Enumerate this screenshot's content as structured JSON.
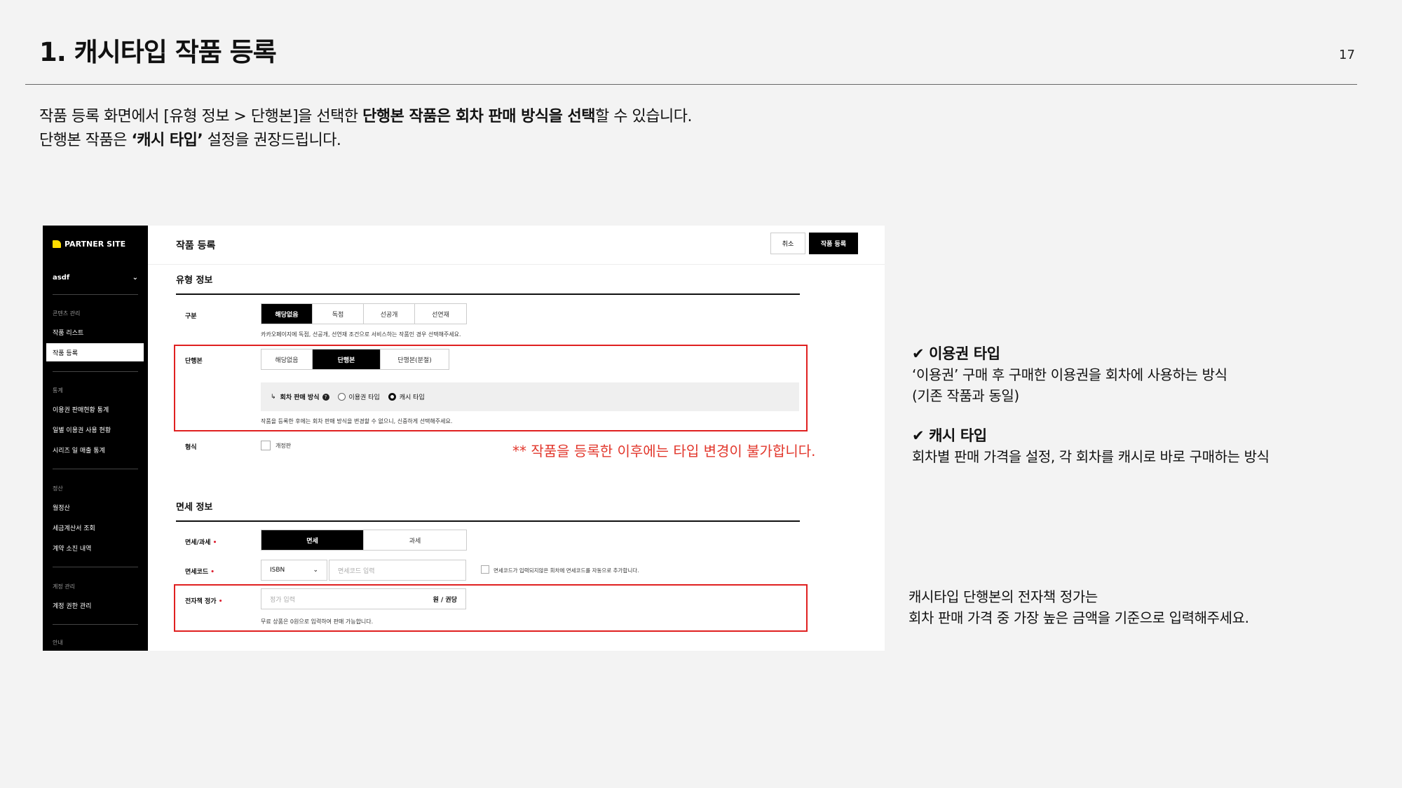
{
  "slide": {
    "title": "1. 캐시타입 작품 등록",
    "page_number": "17",
    "intro_line1_a": "작품 등록 화면에서 [유형 정보 > 단행본]을 선택한 ",
    "intro_line1_b": "단행본 작품은 회차 판매 방식을 선택",
    "intro_line1_c": "할 수 있습니다.",
    "intro_line2_a": "단행본 작품은 ",
    "intro_line2_b": "‘캐시 타입’",
    "intro_line2_c": " 설정을 권장드립니다."
  },
  "sidebar": {
    "logo": "PARTNER SITE",
    "account": "asdf",
    "account_chevron": "⌄",
    "sections": {
      "content": "콘텐츠 관리",
      "stats": "통계",
      "settle": "정산",
      "account": "계정 관리",
      "guide": "안내"
    },
    "items": {
      "work_list": "작품 리스트",
      "work_register": "작품 등록",
      "ticket_sales_stats": "이용권 판매현황 통계",
      "daily_ticket_usage": "일별 이용권 사용 현황",
      "series_sales_stats": "시리즈 일 매출 통계",
      "monthly_settle": "월정산",
      "tax_invoice": "세금계산서 조회",
      "contract_history": "계약 소진 내역",
      "account_auth": "계정 권한 관리"
    }
  },
  "form": {
    "page_title": "작품 등록",
    "cancel_label": "취소",
    "submit_label": "작품 등록",
    "type_section_title": "유형 정보",
    "category_label": "구분",
    "category_options": [
      "해당없음",
      "독점",
      "선공개",
      "선연재"
    ],
    "category_hint": "카카오페이지에 독점, 선공개, 선연재 조건으로 서비스하는 작품인 경우 선택해주세요.",
    "volume_label": "단행본",
    "volume_options": [
      "해당없음",
      "단행본",
      "단행본(분절)"
    ],
    "sale_method_arrow": "↳",
    "sale_method_label": "회차 판매 방식",
    "sale_method_help": "?",
    "radio_ticket": "이용권 타입",
    "radio_cash": "캐시 타입",
    "volume_hint": "작품을 등록한 후에는 회차 판매 방식을 변경할 수 없으니, 신중하게 선택해주세요.",
    "format_label": "형식",
    "format_checkbox": "개정판",
    "warning": "** 작품을 등록한 이후에는 타입 변경이 불가합니다.",
    "tax_section_title": "면세 정보",
    "tax_label": "면세/과세",
    "tax_options": [
      "면세",
      "과세"
    ],
    "tax_code_label": "면세코드",
    "tax_code_select": "ISBN",
    "tax_code_placeholder": "면세코드 입력",
    "tax_code_auto": "면세코드가 입력되지않은 회차에 면세코드를 자동으로 추가합니다.",
    "price_label": "전자책 정가",
    "price_placeholder": "정가 입력",
    "price_unit": "원 / 권당",
    "price_hint": "무료 상품은 0원으로 입력하여 판매 가능합니다."
  },
  "notes": {
    "ticket_title": "✔ 이용권 타입",
    "ticket_desc1": "‘이용권’ 구매 후 구매한 이용권을 회차에 사용하는 방식",
    "ticket_desc2": "(기존 작품과 동일)",
    "cash_title": "✔ 캐시 타입",
    "cash_desc": "회차별 판매 가격을 설정, 각 회차를 캐시로 바로 구매하는 방식",
    "price_note1": "캐시타입 단행본의 전자책 정가는",
    "price_note2": "회차 판매 가격 중 가장 높은 금액을 기준으로 입력해주세요."
  },
  "colors": {
    "accent_red": "#e02020",
    "logo_yellow": "#ffdd00",
    "sidebar_bg": "#000000"
  }
}
